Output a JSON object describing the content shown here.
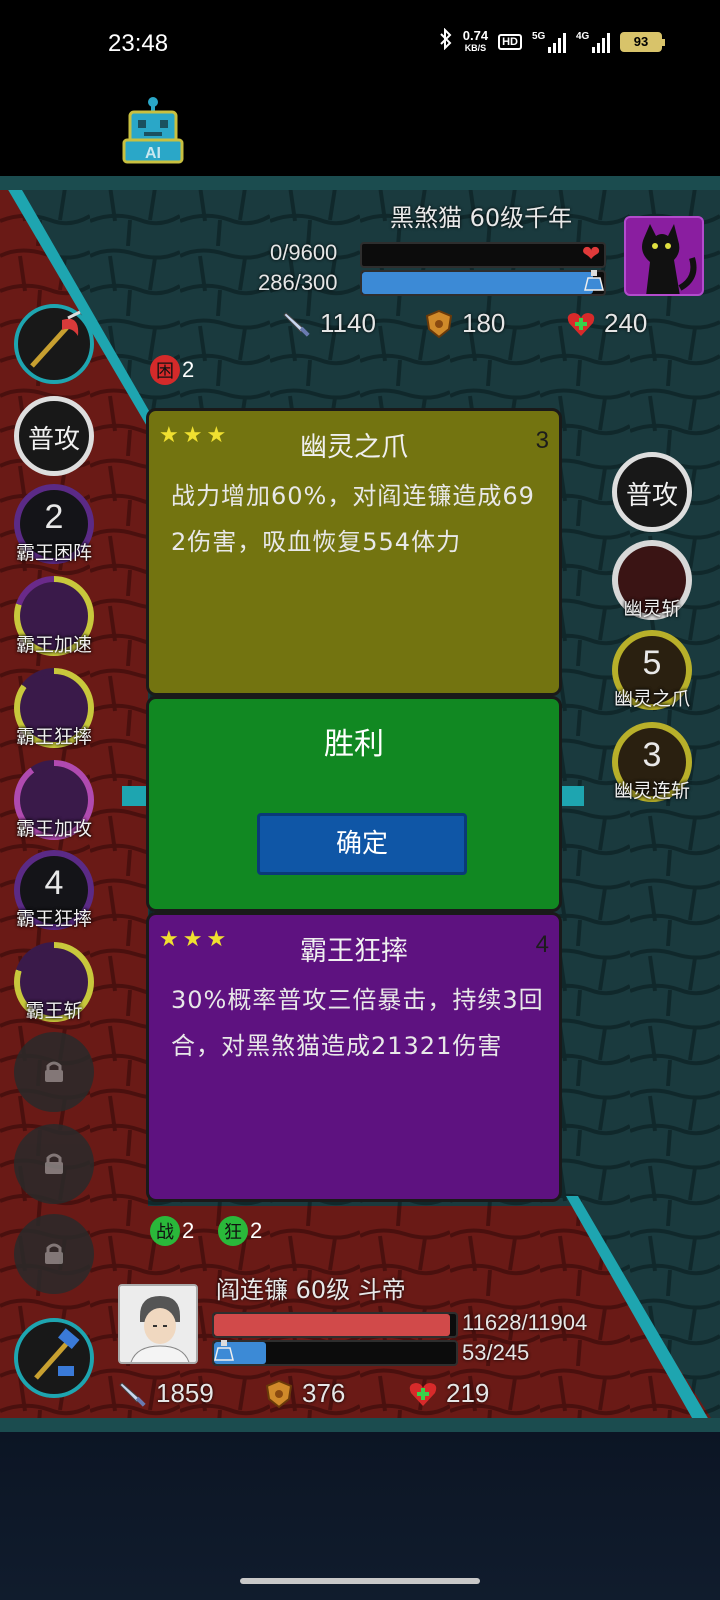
{
  "status_bar": {
    "time": "23:48",
    "net_speed": "0.74",
    "net_unit": "KB/S",
    "hd_label": "HD",
    "signal1_label": "5G",
    "signal2_label": "4G",
    "battery": "93",
    "icons": [
      "bluetooth-icon",
      "signal-icon",
      "battery-icon"
    ]
  },
  "ai_button": {
    "label": "AI",
    "icon": "robot-icon"
  },
  "enemy": {
    "name": "黑煞猫 60级千年",
    "hp_text": "0/9600",
    "hp_fraction": 0,
    "mp_text": "286/300",
    "mp_fraction": 0.953,
    "attack": "1140",
    "defense": "180",
    "heal": "240",
    "status_badges": [
      {
        "char": "困",
        "count": "2",
        "color": "#d42a2a"
      }
    ]
  },
  "left_skills": [
    {
      "label": "普攻",
      "type": "basic"
    },
    {
      "label": "霸王困阵",
      "num": "2",
      "ring": "#5b2a86"
    },
    {
      "label": "霸王加速",
      "num": "",
      "ring": "#c8c83c"
    },
    {
      "label": "霸王狂摔",
      "num": "",
      "ring": "#c8c83c"
    },
    {
      "label": "霸王加攻",
      "num": "",
      "ring": "#b04ab0"
    },
    {
      "label": "霸王狂摔",
      "num": "4",
      "ring": "#5b2a86"
    },
    {
      "label": "霸王斩",
      "num": "",
      "ring": "#c8c83c"
    }
  ],
  "right_skills": [
    {
      "label": "普攻",
      "type": "basic"
    },
    {
      "label": "幽灵斩",
      "num": "",
      "ring": "#d8d8d8"
    },
    {
      "label": "幽灵之爪",
      "num": "5",
      "ring": "#b8b02a"
    },
    {
      "label": "幽灵连斩",
      "num": "3",
      "ring": "#b8b02a"
    }
  ],
  "cards": {
    "top": {
      "stars": "★★★",
      "title": "幽灵之爪",
      "num": "3",
      "desc": "战力增加60%，对阎连镰造成692伤害，吸血恢复554体力"
    },
    "middle": {
      "title": "胜利",
      "button": "确定"
    },
    "bottom": {
      "stars": "★★★",
      "title": "霸王狂摔",
      "num": "4",
      "desc": "30%概率普攻三倍暴击，持续3回合，对黑煞猫造成21321伤害"
    }
  },
  "player": {
    "name": "阎连镰 60级 斗帝",
    "hp_text": "11628/11904",
    "hp_fraction": 0.977,
    "mp_text": "53/245",
    "mp_fraction": 0.216,
    "attack": "1859",
    "defense": "376",
    "heal": "219",
    "status_badges": [
      {
        "char": "战",
        "count": "2",
        "color": "#2ab83a"
      },
      {
        "char": "狂",
        "count": "2",
        "color": "#2ab83a"
      }
    ]
  },
  "colors": {
    "field_bg": "#183338",
    "field_red": "#6a1a16",
    "cyan_accent": "#1ea5b0",
    "card_yellow": "#737410",
    "card_green": "#118822",
    "card_purple": "#5e1280",
    "button_blue": "#0f56a6"
  }
}
